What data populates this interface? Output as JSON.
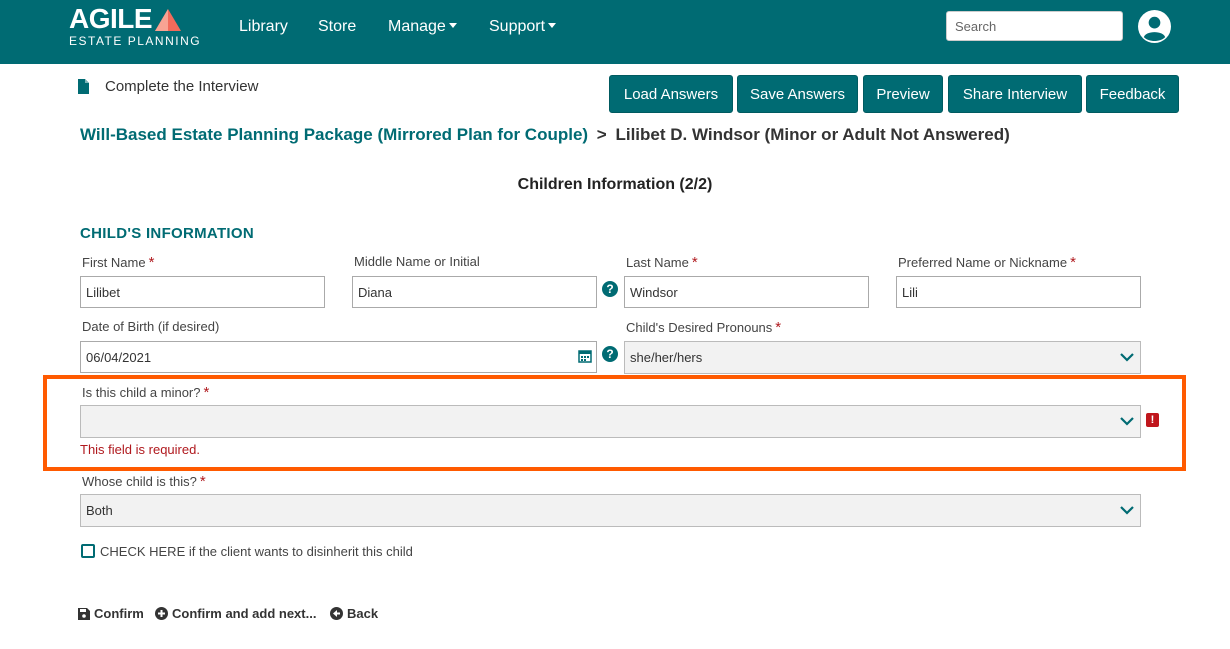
{
  "navbar": {
    "logo_main": "AGILE",
    "logo_sub": "ESTATE PLANNING",
    "links": {
      "library": "Library",
      "store": "Store",
      "manage": "Manage",
      "support": "Support"
    },
    "search_placeholder": "Search",
    "user_icon": "user-circle-icon",
    "colors": {
      "brand": "#006b73",
      "logo_accent": "#f26b5b"
    }
  },
  "subheader": {
    "title": "Complete the Interview",
    "buttons": {
      "load": "Load Answers",
      "save": "Save Answers",
      "preview": "Preview",
      "share": "Share Interview",
      "feedback": "Feedback"
    }
  },
  "breadcrumb": {
    "link": "Will-Based Estate Planning Package (Mirrored Plan for Couple)",
    "separator": ">",
    "current": "Lilibet D. Windsor (Minor or Adult Not Answered)"
  },
  "section_heading": "Children Information (2/2)",
  "form": {
    "group_title": "CHILD'S INFORMATION",
    "required_mark": "*",
    "first_name": {
      "label": "First Name",
      "value": "Lilibet"
    },
    "middle_name": {
      "label": "Middle Name or Initial",
      "value": "Diana"
    },
    "last_name": {
      "label": "Last Name",
      "value": "Windsor"
    },
    "preferred_name": {
      "label": "Preferred Name or Nickname",
      "value": "Lili"
    },
    "dob": {
      "label": "Date of Birth (if desired)",
      "value": "06/04/2021"
    },
    "pronouns": {
      "label": "Child's Desired Pronouns",
      "value": "she/her/hers"
    },
    "is_minor": {
      "label": "Is this child a minor?",
      "value": "",
      "error": "This field is required.",
      "error_icon": "!"
    },
    "whose_child": {
      "label": "Whose child is this?",
      "value": "Both"
    },
    "disinherit": {
      "label": "CHECK HERE if the client wants to disinherit this child",
      "checked": false
    },
    "highlight_color": "#ff5a00",
    "error_color": "#b0191e"
  },
  "actions": {
    "confirm": "Confirm",
    "confirm_add": "Confirm and add next...",
    "back": "Back"
  }
}
